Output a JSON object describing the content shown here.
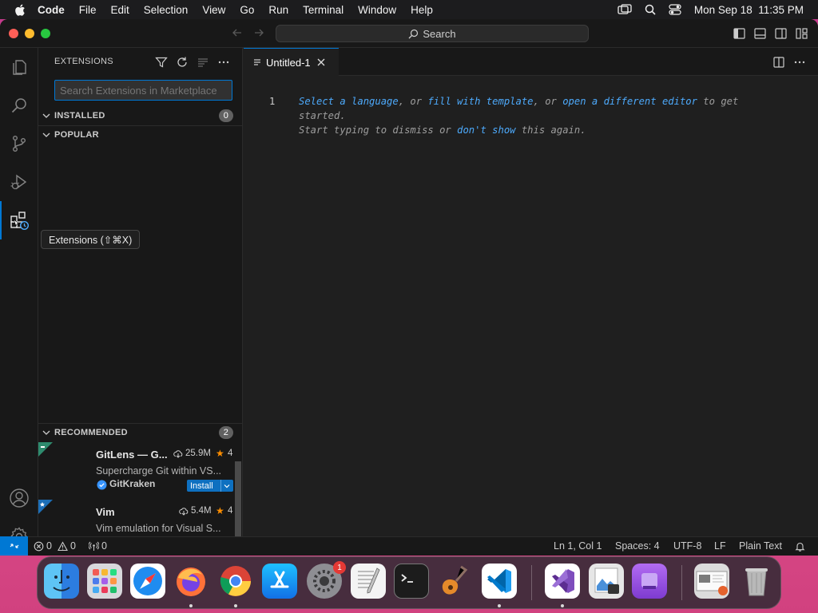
{
  "menubar": {
    "app": "Code",
    "items": [
      "File",
      "Edit",
      "Selection",
      "View",
      "Go",
      "Run",
      "Terminal",
      "Window",
      "Help"
    ],
    "clock": "Mon Sep 18  11:35 PM"
  },
  "titlebar": {
    "search_label": "Search"
  },
  "sidebar": {
    "title": "EXTENSIONS",
    "search_placeholder": "Search Extensions in Marketplace",
    "sections": {
      "installed": {
        "label": "INSTALLED",
        "count": "0"
      },
      "popular": {
        "label": "POPULAR"
      },
      "recommended": {
        "label": "RECOMMENDED",
        "count": "2"
      }
    },
    "extensions": [
      {
        "name": "GitLens — G...",
        "downloads": "25.9M",
        "rating": "4",
        "description": "Supercharge Git within VS...",
        "publisher": "GitKraken",
        "install_label": "Install"
      },
      {
        "name": "Vim",
        "downloads": "5.4M",
        "rating": "4",
        "description": "Vim emulation for Visual S..."
      }
    ]
  },
  "tooltip": "Extensions (⇧⌘X)",
  "editor": {
    "tab_label": "Untitled-1",
    "line_number": "1",
    "hint": {
      "link1": "Select a language",
      "sep1": ", or ",
      "link2": "fill with template",
      "sep2": ", or ",
      "link3": "open a different editor",
      "tail1": " to get",
      "tail2": "started.",
      "line3a": "Start typing to dismiss or ",
      "link4": "don't show",
      "line3b": " this again."
    }
  },
  "statusbar": {
    "errors": "0",
    "warnings": "0",
    "ports": "0",
    "position": "Ln 1, Col 1",
    "spaces": "Spaces: 4",
    "encoding": "UTF-8",
    "eol": "LF",
    "language": "Plain Text"
  },
  "dock": {
    "apps": [
      "Finder",
      "Launchpad",
      "Safari",
      "Firefox",
      "Chrome",
      "App Store",
      "System Settings",
      "TextEdit",
      "Terminal",
      "GarageBand",
      "Visual Studio Code",
      "Visual Studio",
      "Preview",
      "Podcasts",
      "Photo",
      "Trash"
    ],
    "settings_badge": "1"
  },
  "colors": {
    "accent": "#0078d4",
    "link": "#4daafc",
    "install": "#0e70c0"
  }
}
